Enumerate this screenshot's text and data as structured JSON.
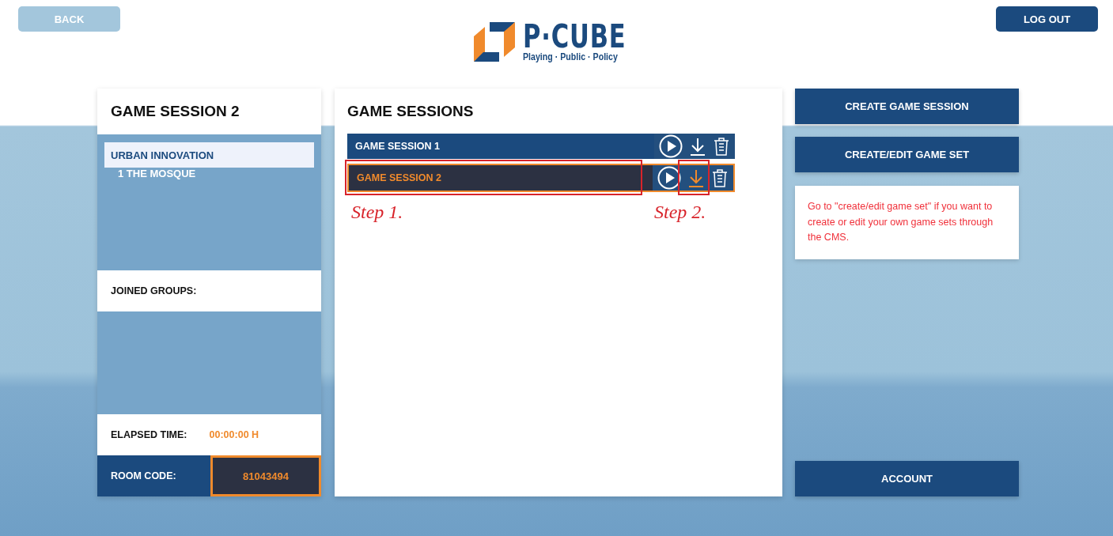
{
  "header": {
    "back_button": "BACK",
    "logo": {
      "title": "P·CUBE",
      "tagline": "Playing · Public · Policy"
    },
    "logout_button": "LOG OUT"
  },
  "session_panel": {
    "title": "GAME SESSION 2",
    "game_sets": [
      {
        "label": "URBAN INNOVATION",
        "selected": true,
        "children": [
          {
            "label": "1 THE MOSQUE",
            "selected": false
          }
        ]
      }
    ],
    "joined_groups_label": "JOINED GROUPS:",
    "elapsed_time_label": "ELAPSED TIME:",
    "elapsed_time": "00:00:00 H",
    "room_code_label": "ROOM CODE:",
    "room_code": "81043494"
  },
  "sessions_panel": {
    "title": "GAME SESSIONS",
    "sessions": [
      {
        "name": "GAME SESSION 1",
        "selected": false
      },
      {
        "name": "GAME SESSION 2",
        "selected": true
      }
    ],
    "annotations": [
      {
        "label": "Step 1.",
        "kind": "name"
      },
      {
        "label": "Step 2.",
        "kind": "download"
      }
    ]
  },
  "actions": {
    "buttons": [
      "CREATE GAME SESSION",
      "CREATE/EDIT GAME SET"
    ],
    "note": "Go to \"create/edit game set\" if you want to create or edit your own game sets through the CMS.",
    "account_button": "ACCOUNT"
  }
}
